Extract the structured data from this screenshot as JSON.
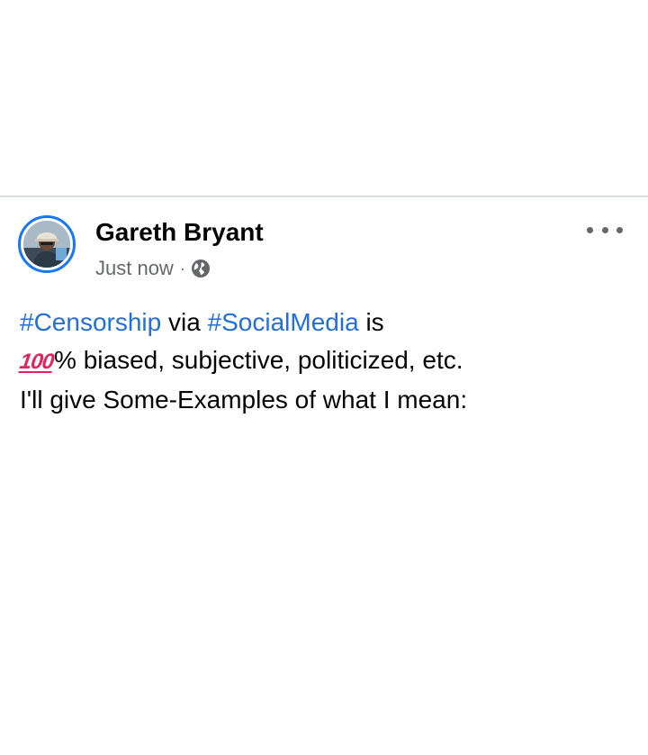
{
  "post": {
    "author_name": "Gareth Bryant",
    "timestamp": "Just now",
    "separator": "·",
    "audience_icon": "globe-icon",
    "more_icon": "more-options-icon",
    "avatar_icon": "profile-photo",
    "body": {
      "line1": {
        "tag1": "#Censorship",
        "mid": " via ",
        "tag2": "#SocialMedia",
        "end": " is"
      },
      "line2": {
        "emoji": "100",
        "rest": "% biased, subjective, politicized, etc."
      },
      "line3": "I'll give Some-Examples of what I mean:"
    }
  },
  "colors": {
    "hashtag": "#216fdb",
    "avatar_ring": "#1877f2",
    "text_primary": "#050505",
    "text_secondary": "#65676b",
    "emoji_red": "#e0245e",
    "divider": "#dadde1"
  }
}
